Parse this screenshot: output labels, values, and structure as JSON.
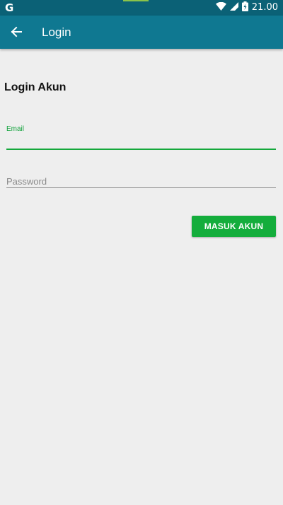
{
  "status_bar": {
    "left_icon": "google-g-icon",
    "left_glyph": "G",
    "icons": [
      "wifi-icon",
      "signal-icon",
      "battery-icon"
    ],
    "time": "21.00"
  },
  "app_bar": {
    "back_icon": "arrow-left-icon",
    "title": "Login"
  },
  "form": {
    "heading": "Login Akun",
    "email": {
      "label": "Email",
      "value": ""
    },
    "password": {
      "placeholder": "Password",
      "value": ""
    },
    "submit_label": "MASUK AKUN"
  },
  "colors": {
    "status_bar": "#0b6176",
    "app_bar": "#0f7891",
    "accent_green": "#14ad3c",
    "background": "#eeeeee"
  }
}
